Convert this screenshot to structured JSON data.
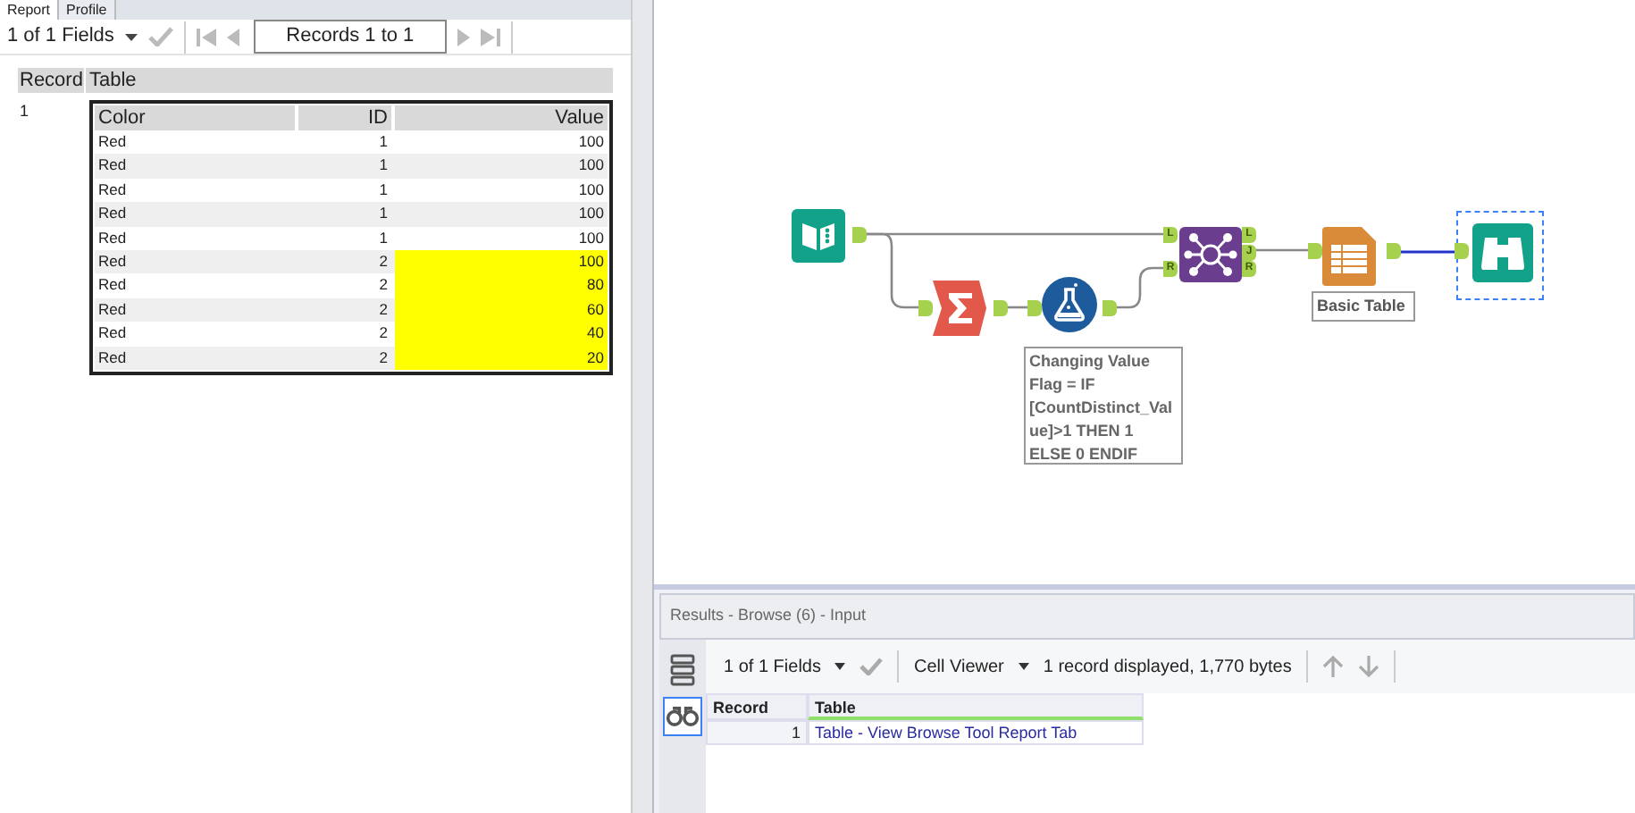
{
  "report_tabs": [
    {
      "label": "Report",
      "selected": true
    },
    {
      "label": "Profile",
      "selected": false
    }
  ],
  "report_toolbar": {
    "fields": "1 of 1 Fields",
    "records": "Records 1 to 1"
  },
  "report": {
    "columns": [
      "Record",
      "Table"
    ],
    "record": "1",
    "table": {
      "columns": [
        "Color",
        "ID",
        "Value"
      ],
      "rows": [
        {
          "cells": [
            "Red",
            "1",
            "100"
          ],
          "highlighted": false
        },
        {
          "cells": [
            "Red",
            "1",
            "100"
          ],
          "highlighted": false
        },
        {
          "cells": [
            "Red",
            "1",
            "100"
          ],
          "highlighted": false
        },
        {
          "cells": [
            "Red",
            "1",
            "100"
          ],
          "highlighted": false
        },
        {
          "cells": [
            "Red",
            "1",
            "100"
          ],
          "highlighted": false
        },
        {
          "cells": [
            "Red",
            "2",
            "100"
          ],
          "highlighted": true
        },
        {
          "cells": [
            "Red",
            "2",
            "80"
          ],
          "highlighted": true
        },
        {
          "cells": [
            "Red",
            "2",
            "60"
          ],
          "highlighted": true
        },
        {
          "cells": [
            "Red",
            "2",
            "40"
          ],
          "highlighted": true
        },
        {
          "cells": [
            "Red",
            "2",
            "20"
          ],
          "highlighted": true
        }
      ]
    }
  },
  "workflow": {
    "join_inputs": [
      "L",
      "R"
    ],
    "join_outputs": [
      "L",
      "J",
      "R"
    ],
    "table_label": "Basic Table",
    "annotation_lines": [
      "Changing Value",
      "Flag = IF",
      "[CountDistinct_Val",
      "ue]>1 THEN 1",
      "ELSE 0 ENDIF"
    ],
    "browse_selected": true
  },
  "results": {
    "title": "Results - Browse (6) - Input",
    "fields": "1 of 1 Fields",
    "viewer": "Cell Viewer",
    "summary": "1 record displayed, 1,770 bytes",
    "columns": [
      "Record",
      "Table"
    ],
    "rows": [
      {
        "record": "1",
        "table": "Table - View Browse Tool Report Tab"
      }
    ]
  }
}
